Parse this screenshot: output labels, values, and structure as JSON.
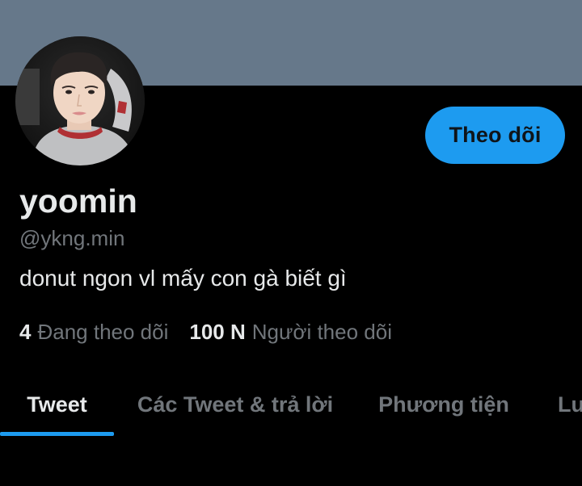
{
  "profile": {
    "display_name": "yoomin",
    "handle": "@ykng.min",
    "bio": "donut ngon vl mấy con gà biết gì"
  },
  "follow_button": {
    "label": "Theo dõi"
  },
  "stats": {
    "following_count": "4",
    "following_label": "Đang theo dõi",
    "followers_count": "100 N",
    "followers_label": "Người theo dõi"
  },
  "tabs": [
    {
      "label": "Tweet",
      "active": true
    },
    {
      "label": "Các Tweet & trả lời",
      "active": false
    },
    {
      "label": "Phương tiện",
      "active": false
    },
    {
      "label": "Lượt thích",
      "active": false
    }
  ],
  "colors": {
    "banner": "#66788a",
    "accent": "#1d9bf0",
    "background": "#000000",
    "primary_text": "#e7e9ea",
    "secondary_text": "#71767b"
  }
}
